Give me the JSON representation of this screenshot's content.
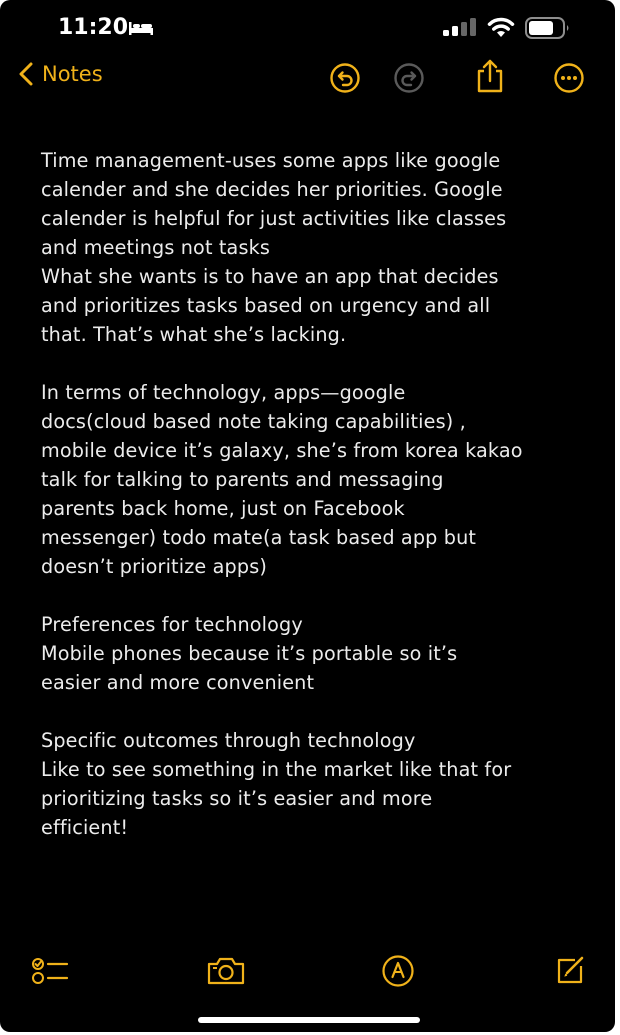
{
  "status_bar": {
    "time": "11:20"
  },
  "nav": {
    "back_label": "Notes"
  },
  "note": {
    "lines": [
      "Time management-uses some apps like google",
      "calender and she decides her priorities. Google",
      "calender is helpful for just activities like classes",
      "and meetings not tasks",
      "What she wants is to have an app that decides",
      "and prioritizes tasks based on urgency and all",
      "that. That’s what she’s lacking.",
      "",
      "In terms of technology, apps—google",
      "docs(cloud based note taking capabilities) ,",
      "mobile device it’s galaxy, she’s from korea kakao",
      "talk for talking to parents and messaging",
      "parents back home, just on Facebook",
      "messenger) todo mate(a task based app but",
      "doesn’t prioritize apps)",
      "",
      "Preferences for technology",
      "Mobile phones because it’s portable so it’s",
      "easier and more convenient",
      "",
      "Specific outcomes through technology",
      "Like to see something in the market like that for",
      "prioritizing tasks so it’s easier and more",
      "efficient!"
    ]
  },
  "icons": {
    "back": "chevron-left-icon",
    "undo": "undo-icon",
    "redo": "redo-icon",
    "share": "share-icon",
    "more": "more-icon",
    "checklist": "checklist-icon",
    "camera": "camera-icon",
    "markup": "markup-icon",
    "compose": "compose-icon"
  },
  "colors": {
    "accent": "#f0b21a",
    "background": "#000000",
    "text": "#ececec",
    "disabled": "#5a5a5a"
  }
}
